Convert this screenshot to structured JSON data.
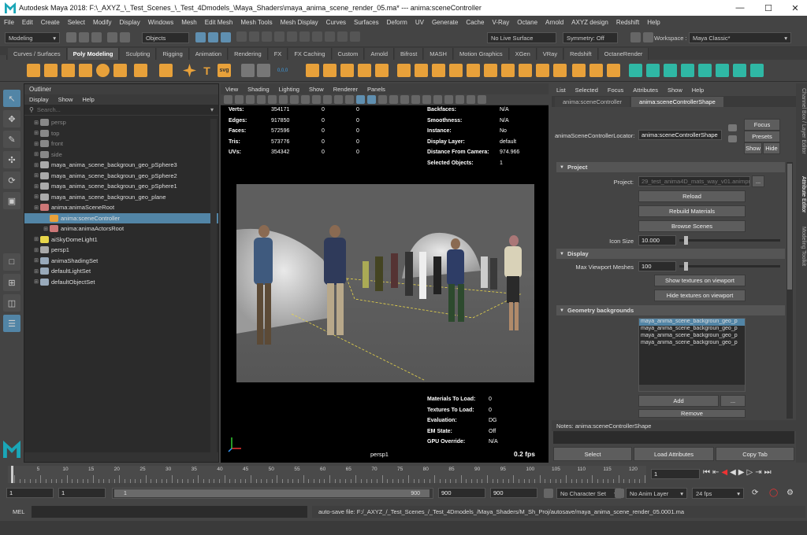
{
  "window": {
    "title": "Autodesk Maya 2018: F:\\_AXYZ_\\_Test_Scenes_\\_Test_4Dmodels_\\Maya_Shaders\\maya_anima_scene_render_05.ma*   ---   anima:sceneController"
  },
  "menubar": [
    "File",
    "Edit",
    "Create",
    "Select",
    "Modify",
    "Display",
    "Windows",
    "Mesh",
    "Edit Mesh",
    "Mesh Tools",
    "Mesh Display",
    "Curves",
    "Surfaces",
    "Deform",
    "UV",
    "Generate",
    "Cache",
    "V-Ray",
    "Octane",
    "Arnold",
    "AXYZ design",
    "Redshift",
    "Help"
  ],
  "workspace": {
    "label": "Workspace :",
    "value": "Maya Classic*"
  },
  "statusline": {
    "mode": "Modeling",
    "objects": "Objects",
    "live_surface": "No Live Surface",
    "symmetry": "Symmetry: Off"
  },
  "shelf_tabs": [
    "Curves / Surfaces",
    "Poly Modeling",
    "Sculpting",
    "Rigging",
    "Animation",
    "Rendering",
    "FX",
    "FX Caching",
    "Custom",
    "Arnold",
    "Bifrost",
    "MASH",
    "Motion Graphics",
    "XGen",
    "VRay",
    "Redshift",
    "OctaneRender"
  ],
  "shelf_active": "Poly Modeling",
  "shelf_icons": {
    "text_icon": "T",
    "svg_icon": "svg",
    "xyz_icon": "0,0,0"
  },
  "outliner": {
    "title": "Outliner",
    "menu": [
      "Display",
      "Show",
      "Help"
    ],
    "search_placeholder": "Search...",
    "items": [
      {
        "label": "persp",
        "dim": true
      },
      {
        "label": "top",
        "dim": true
      },
      {
        "label": "front",
        "dim": true
      },
      {
        "label": "side",
        "dim": true
      },
      {
        "label": "maya_anima_scene_backgroun_geo_pSphere3"
      },
      {
        "label": "maya_anima_scene_backgroun_geo_pSphere2"
      },
      {
        "label": "maya_anima_scene_backgroun_geo_pSphere1"
      },
      {
        "label": "maya_anima_scene_backgroun_geo_plane"
      },
      {
        "label": "anima:animaSceneRoot"
      },
      {
        "label": "anima:sceneController",
        "selected": true
      },
      {
        "label": "anima:animaActorsRoot"
      },
      {
        "label": "aiSkyDomeLight1"
      },
      {
        "label": "persp1"
      },
      {
        "label": "animaShadingSet"
      },
      {
        "label": "defaultLightSet"
      },
      {
        "label": "defaultObjectSet"
      }
    ]
  },
  "viewport": {
    "menu": [
      "View",
      "Shading",
      "Lighting",
      "Show",
      "Renderer",
      "Panels"
    ],
    "hud_left": [
      {
        "k": "Verts:",
        "a": "354171",
        "b": "0",
        "c": "0"
      },
      {
        "k": "Edges:",
        "a": "917850",
        "b": "0",
        "c": "0"
      },
      {
        "k": "Faces:",
        "a": "572596",
        "b": "0",
        "c": "0"
      },
      {
        "k": "Tris:",
        "a": "573776",
        "b": "0",
        "c": "0"
      },
      {
        "k": "UVs:",
        "a": "354342",
        "b": "0",
        "c": "0"
      }
    ],
    "hud_right": [
      {
        "k": "Backfaces:",
        "v": "N/A"
      },
      {
        "k": "Smoothness:",
        "v": "N/A"
      },
      {
        "k": "Instance:",
        "v": "No"
      },
      {
        "k": "Display Layer:",
        "v": "default"
      },
      {
        "k": "Distance From Camera:",
        "v": "974.966"
      },
      {
        "k": "Selected Objects:",
        "v": "1"
      }
    ],
    "hud_bottom": [
      {
        "k": "Materials To Load:",
        "v": "0"
      },
      {
        "k": "Textures To Load:",
        "v": "0"
      },
      {
        "k": "Evaluation:",
        "v": "DG"
      },
      {
        "k": "EM State:",
        "v": "Off"
      },
      {
        "k": "GPU Override:",
        "v": "N/A"
      }
    ],
    "camera": "persp1",
    "fps": "0.2 fps"
  },
  "attr": {
    "menu": [
      "List",
      "Selected",
      "Focus",
      "Attributes",
      "Show",
      "Help"
    ],
    "tabs": [
      "anima:sceneController",
      "anima:sceneControllerShape"
    ],
    "node_label": "animaSceneControllerLocator:",
    "node_value": "anima:sceneControllerShape",
    "focus": "Focus",
    "presets": "Presets",
    "show": "Show",
    "hide": "Hide",
    "sec_project": "Project",
    "project_label": "Project:",
    "project_value": "29_test_anima4D_mats_way_v01.animprj",
    "browse": "...",
    "reload": "Reload",
    "rebuild": "Rebuild Materials",
    "browse_scenes": "Browse Scenes",
    "icon_size_label": "Icon Size",
    "icon_size": "10.000",
    "icon_size_level": 0.05,
    "sec_display": "Display",
    "max_meshes_label": "Max Viewport Meshes",
    "max_meshes": "100",
    "max_meshes_level": 0.05,
    "show_tex": "Show textures on viewport",
    "hide_tex": "Hide textures on viewport",
    "sec_geo": "Geometry backgrounds",
    "geo_list": [
      "maya_anima_scene_backgroun_geo_p",
      "maya_anima_scene_backgroun_geo_p",
      "maya_anima_scene_backgroun_geo_p",
      "maya_anima_scene_backgroun_geo_p"
    ],
    "add": "Add",
    "dots": "...",
    "remove": "Remove",
    "notes": "Notes:  anima:sceneControllerShape",
    "btn_select": "Select",
    "btn_load": "Load Attributes",
    "btn_copy": "Copy Tab"
  },
  "right_tabs": [
    "Channel Box / Layer Editor",
    "Attribute Editor",
    "Modeling Toolkit"
  ],
  "timeline": {
    "ticks": [
      "5",
      "10",
      "15",
      "20",
      "25",
      "30",
      "35",
      "40",
      "45",
      "50",
      "55",
      "60",
      "65",
      "70",
      "75",
      "80",
      "85",
      "90",
      "95",
      "100",
      "105",
      "110",
      "115",
      "120"
    ],
    "current_frame": "1"
  },
  "range": {
    "start": "1",
    "start2": "1",
    "slider_start": "1",
    "slider_end": "900",
    "end": "900",
    "end2": "900",
    "character": "No Character Set",
    "anim_layer": "No Anim Layer",
    "fps": "24 fps"
  },
  "command": {
    "lang": "MEL",
    "message": "auto-save file: F:/_AXYZ_/_Test_Scenes_/_Test_4Dmodels_/Maya_Shaders/M_Sh_Proj/autosave/maya_anima_scene_render_05.0001.ma"
  },
  "colors": {
    "accent": "#1aa6b7",
    "selected": "#5285a6",
    "shelf_orange": "#e8a13a",
    "shelf_teal": "#2fb8a5",
    "shelf_blue": "#3d9be0"
  }
}
